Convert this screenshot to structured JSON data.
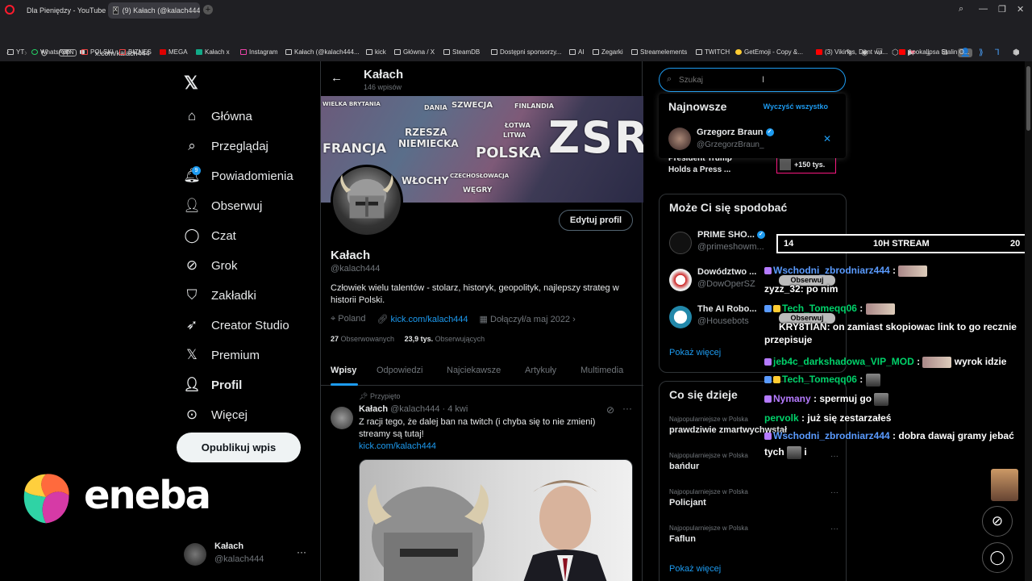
{
  "browser": {
    "tabs": [
      {
        "label": "Dla Pieniędzy - YouTube"
      },
      {
        "label": "(9) Kałach (@kalach444) /"
      }
    ],
    "url": "x.com/kalach444",
    "vpn_label": "VPN",
    "bookmarks": [
      "YT",
      "WhatsApp",
      "POLSKI",
      "BIZNES",
      "MEGA",
      "Kałach x",
      "Instagram",
      "Kałach (@kalach444...",
      "kick",
      "Główna / X",
      "SteamDB",
      "Dostępni sponsorzy...",
      "AI",
      "Zegarki",
      "Streamelements",
      "TWITCH",
      "GetEmoji - Copy &...",
      "(3) Vikings, Dont wa...",
      "Apokalipsa Stalin O..."
    ]
  },
  "sidebar": {
    "items": [
      {
        "label": "Główna",
        "icon": "home-icon"
      },
      {
        "label": "Przeglądaj",
        "icon": "search-icon"
      },
      {
        "label": "Powiadomienia",
        "icon": "bell-icon",
        "badge": "9"
      },
      {
        "label": "Obserwuj",
        "icon": "follow-icon"
      },
      {
        "label": "Czat",
        "icon": "chat-icon"
      },
      {
        "label": "Grok",
        "icon": "grok-icon"
      },
      {
        "label": "Zakładki",
        "icon": "bookmark-icon"
      },
      {
        "label": "Creator Studio",
        "icon": "rocket-icon"
      },
      {
        "label": "Premium",
        "icon": "x-icon"
      },
      {
        "label": "Profil",
        "icon": "person-icon"
      },
      {
        "label": "Więcej",
        "icon": "more-icon"
      }
    ],
    "post_button": "Opublikuj wpis",
    "account": {
      "name": "Kałach",
      "handle": "@kalach444",
      "more": "···"
    }
  },
  "sponsor": {
    "text": "eneba"
  },
  "profile": {
    "title": "Kałach",
    "posts_count": "146 wpisów",
    "banner_labels": [
      "WIELKA BRYTANIA",
      "DANIA",
      "SZWECJA",
      "FINLANDIA",
      "RZESZA",
      "NIEMIECKA",
      "FRANCJA",
      "POLSKA",
      "ZSR",
      "ŁOTWA",
      "LITWA",
      "WŁOCHY",
      "CZECHOSŁOWACJA",
      "WĘGRY"
    ],
    "edit_button": "Edytuj profil",
    "name": "Kałach",
    "handle": "@kalach444",
    "bio": "Człowiek wielu talentów - stolarz, historyk, geopolityk, najlepszy strateg w historii Polski.",
    "location": "Poland",
    "link": "kick.com/kalach444",
    "joined": "Dołączył/a maj 2022",
    "following_count": "27",
    "following_label": "Obserwowanych",
    "followers_count": "23,9 tys.",
    "followers_label": "Obserwujących",
    "tabs": [
      "Wpisy",
      "Odpowiedzi",
      "Najciekawsze",
      "Artykuły",
      "Multimedia"
    ]
  },
  "tweet": {
    "pinned": "Przypięto",
    "name": "Kałach",
    "handle_time": "@kalach444 · 4 kwi",
    "text": "Z racji tego, że dalej ban na twitch (i chyba się to nie zmieni) streamy są tutaj!",
    "link": "kick.com/kalach444"
  },
  "search": {
    "placeholder": "Szukaj",
    "recent_title": "Najnowsze",
    "clear_all": "Wyczyść wszystko",
    "recent": {
      "name": "Grzegorz Braun",
      "handle": "@GrzegorzBraun_"
    }
  },
  "trend_partial": {
    "line1": "President Trump",
    "line2": "Holds a Press ...",
    "count": "+150 tys."
  },
  "who_to_follow": {
    "title": "Może Ci się spodobać",
    "items": [
      {
        "name": "PRIME SHO...",
        "handle": "@primeshowm..."
      },
      {
        "name": "Dowództwo ...",
        "handle": "@DowOperSZ"
      },
      {
        "name": "The AI Robo...",
        "handle": "@Housebots"
      }
    ],
    "more": "Pokaż więcej"
  },
  "whats_happening": {
    "title": "Co się dzieje",
    "items": [
      {
        "context": "Najpopularniejsze w Polska",
        "title": "prawdziwie zmartwychwstał"
      },
      {
        "context": "Najpopularniejsze w Polska",
        "title": "bańdur"
      },
      {
        "context": "Najpopularniejsze w Polska",
        "title": "Policjant"
      },
      {
        "context": "Najpopularniejsze w Polska",
        "title": "Faflun"
      }
    ],
    "more": "Pokaż więcej"
  },
  "stream_overlay": {
    "left": "14",
    "center": "10H STREAM",
    "right": "20"
  },
  "chat": [
    {
      "user": "Wschodni_zbrodniarz444",
      "msg": ":",
      "color": "#5a9bff"
    },
    {
      "user": "zyzz_32",
      "msg": ": po nim",
      "color": "#ffffff"
    },
    {
      "user": "Tech_Tomeqq06",
      "msg": ":",
      "color": "#00d26a"
    },
    {
      "user": "KRY8TIAN",
      "msg": ": on zamiast skopiowac link to go recznie",
      "color": "#ffffff"
    },
    {
      "user": "",
      "msg": "przepisuje",
      "color": "#ffffff"
    },
    {
      "user": "jeb4c_darkshadowa_VIP_MOD",
      "msg": ":",
      "color": "#00d26a"
    },
    {
      "user": "",
      "msg": "wyrok idzie",
      "color": "#ffffff"
    },
    {
      "user": "Tech_Tomeqq06",
      "msg": ":",
      "color": "#00d26a"
    },
    {
      "user": "Nymany",
      "msg": ": spermuj go",
      "color": "#b57bff"
    },
    {
      "user": "pervolk",
      "msg": ": już się zestarzałeś",
      "color": "#00d26a"
    },
    {
      "user": "Wschodni_zbrodniarz444",
      "msg": ": dobra dawaj gramy jebać",
      "color": "#5a9bff"
    },
    {
      "user": "",
      "msg": "tych",
      "color": "#ffffff"
    },
    {
      "user": "",
      "msg": "i",
      "color": "#ffffff"
    }
  ],
  "follow_pill": "Obserwuj",
  "colors": {
    "accent": "#1d9bf0",
    "bg": "#000000",
    "muted": "#71767b"
  }
}
